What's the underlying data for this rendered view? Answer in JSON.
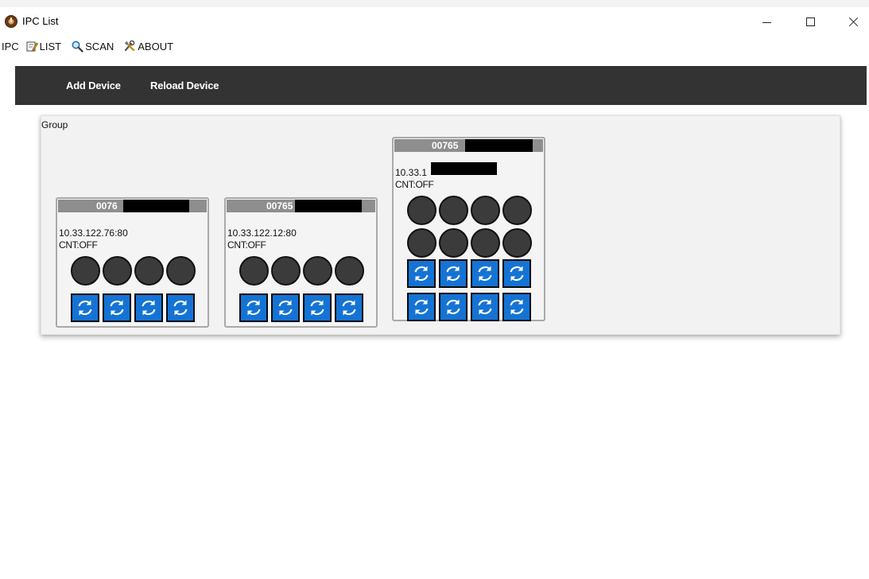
{
  "window": {
    "title": "IPC List"
  },
  "menu": {
    "app": "IPC",
    "list": "LIST",
    "scan": "SCAN",
    "about": "ABOUT"
  },
  "toolbar": {
    "add_device": "Add Device",
    "reload_device": "Reload Device"
  },
  "group": {
    "label": "Group"
  },
  "devices": [
    {
      "id_visible": "0076",
      "ip_visible": "10.33.122.76:80",
      "cnt": "CNT:OFF"
    },
    {
      "id_visible": "00765",
      "ip_visible": "10.33.122.12:80",
      "cnt": "CNT:OFF"
    },
    {
      "id_visible": "00765",
      "ip_visible": "10.33.1",
      "cnt": "CNT:OFF"
    }
  ],
  "colors": {
    "toolbar_bg": "#333333",
    "refresh_button": "#1473d4",
    "led_off": "#3b3b3b",
    "card_header": "#8e8e8e"
  },
  "icons": {
    "app": "app-logo-icon",
    "list": "notepad-edit-icon",
    "scan": "magnifier-icon",
    "about": "tools-icon",
    "refresh": "refresh-icon"
  }
}
